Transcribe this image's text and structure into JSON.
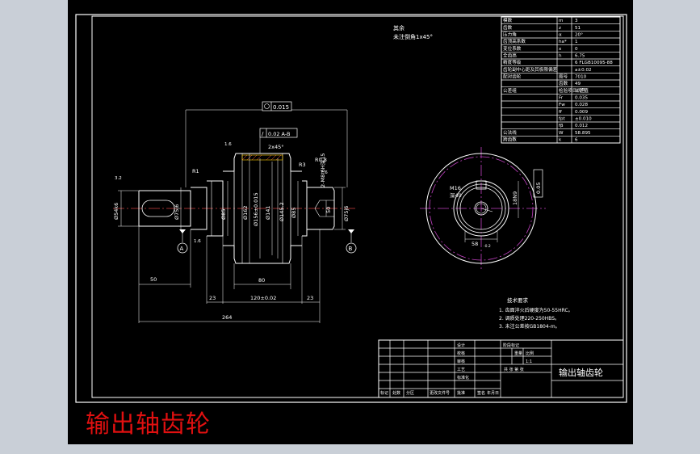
{
  "caption": "输出轴齿轮",
  "title_block": {
    "part_name": "输出轴齿轮",
    "cells": [
      "设计",
      "校核",
      "审核",
      "工艺",
      "标准化",
      "批准",
      "阶段标记",
      "重量",
      "比例",
      "1:1",
      "共  张  第  张",
      "标记",
      "处数",
      "分区",
      "更改文件号",
      "签名",
      "年月日"
    ]
  },
  "notes": {
    "material": "其余",
    "chamfer": "未注倒角1x45°",
    "tech_title": "技术要求",
    "tech_items": [
      "1. 齿面淬火后硬度为50-55HRC。",
      "2. 调质处理220-250HBS。",
      "3. 未注公差按GB1804-m。"
    ]
  },
  "param_table": {
    "rows": [
      [
        "模数",
        "m",
        "3"
      ],
      [
        "齿数",
        "z",
        "51"
      ],
      [
        "压力角",
        "α",
        "20°"
      ],
      [
        "齿顶高系数",
        "ha*",
        "1"
      ],
      [
        "变位系数",
        "x",
        "0"
      ],
      [
        "全齿高",
        "h",
        "6.75"
      ],
      [
        "精度等级",
        "",
        "6 FLGB10095-88"
      ],
      [
        "齿轮副中心距及其极限偏差",
        "",
        "a±0.02"
      ],
      [
        "配对齿轮",
        "图号",
        "7010"
      ],
      [
        "",
        "齿数",
        "49"
      ],
      [
        "公差组",
        "检验项目代号",
        "公差值"
      ],
      [
        "",
        "Fr",
        "0.035"
      ],
      [
        "",
        "Fw",
        "0.028"
      ],
      [
        "",
        "ff",
        "0.009"
      ],
      [
        "",
        "fpt",
        "±0.010"
      ],
      [
        "",
        "fβ",
        "0.012"
      ],
      [
        "公法线",
        "W",
        "58.895"
      ],
      [
        "跨齿数",
        "k",
        "6"
      ]
    ]
  },
  "dims": {
    "runout": "0.015",
    "flatness": "0.02 A-B",
    "chamfer_top": "2x45°",
    "r1": "R1",
    "r08": "R0.8",
    "r3": "R3",
    "thread": "2-M8-6H深15",
    "d54": "Ø54k6",
    "d75a": "Ø75j6",
    "d85a": "Ø85",
    "d162": "Ø162",
    "d156": "Ø156±0.015",
    "d141": "Ø141",
    "d1452": "Ø145.2",
    "d85b": "Ø85",
    "d50": "50",
    "d75b": "Ø75j6",
    "ra1": "1.6",
    "ra2": "1.6",
    "ra3": "1.6",
    "ra4": "3.2",
    "len50": "50",
    "len80": "80",
    "len23a": "23",
    "len120": "120±0.02",
    "len23b": "23",
    "len264": "264",
    "keyway_w": "18N9",
    "keyway_d": "58",
    "keyway_tol": "-0.2",
    "keyway_tol2": "0.05",
    "mk16": "M16",
    "depth": "深40",
    "datum_a": "A",
    "datum_b": "B"
  }
}
